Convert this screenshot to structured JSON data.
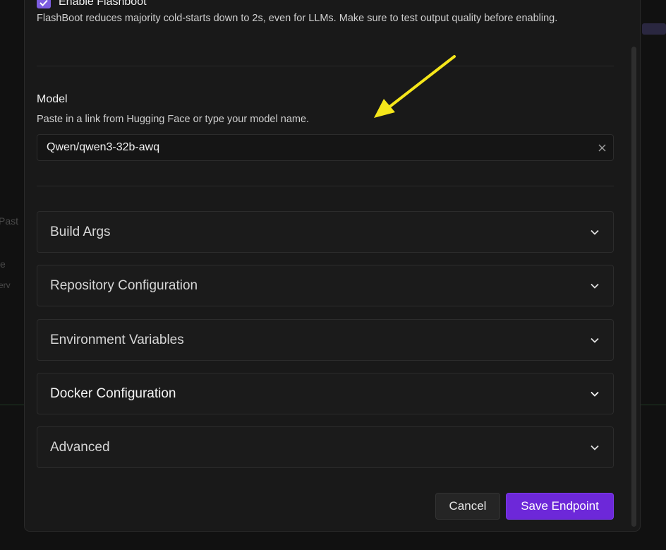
{
  "background": {
    "fragment_1": "Past",
    "fragment_2": "e",
    "fragment_3": "erv"
  },
  "flashboot": {
    "title": "Enable Flashboot",
    "description": "FlashBoot reduces majority cold-starts down to 2s, even for LLMs. Make sure to test output quality before enabling.",
    "checked": true
  },
  "model": {
    "label": "Model",
    "help": "Paste in a link from Hugging Face or type your model name.",
    "value": "Qwen/qwen3-32b-awq",
    "clear_icon": "close-icon"
  },
  "sections": [
    {
      "label": "Build Args"
    },
    {
      "label": "Repository Configuration"
    },
    {
      "label": "Environment Variables"
    },
    {
      "label": "Docker Configuration"
    },
    {
      "label": "Advanced"
    }
  ],
  "actions": {
    "cancel_label": "Cancel",
    "save_label": "Save Endpoint"
  },
  "colors": {
    "accent": "#6d28d9",
    "checkbox": "#7c5ce0",
    "annotation_arrow": "#f5e61a"
  }
}
